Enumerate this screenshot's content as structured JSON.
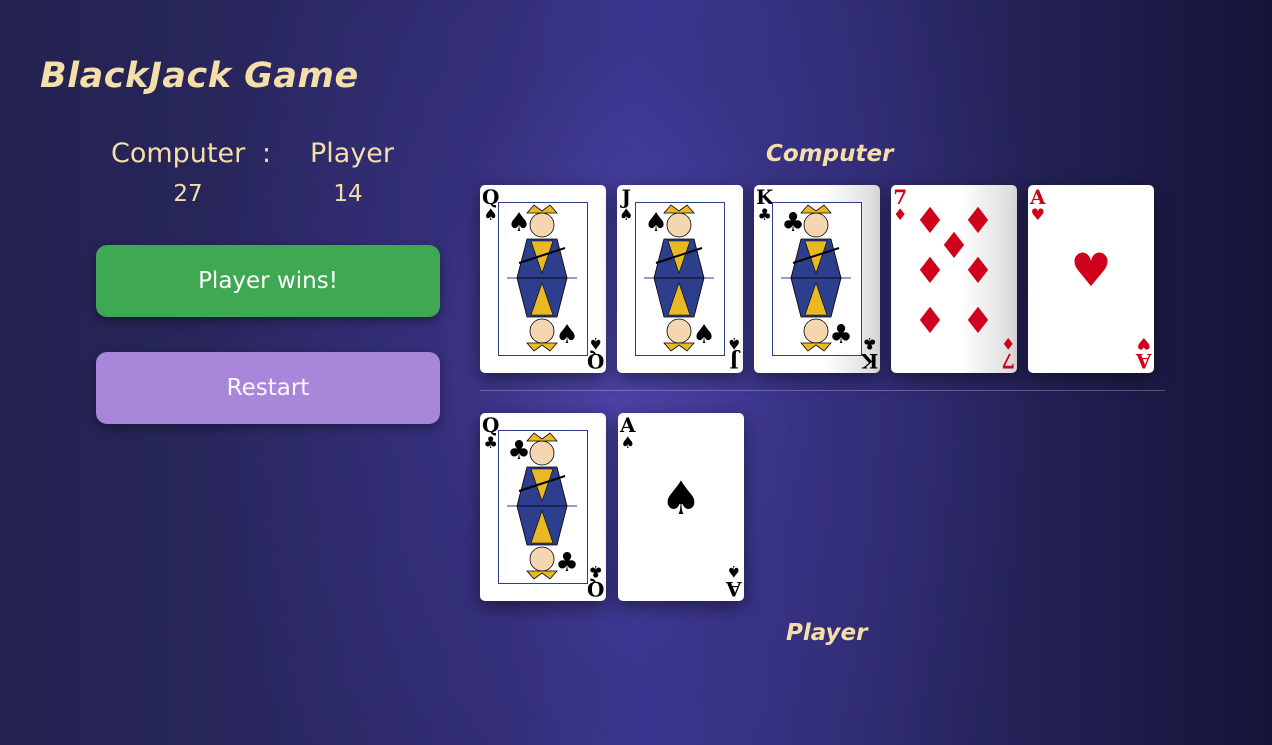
{
  "title": "BlackJack Game",
  "scoreboard": {
    "computer_label": "Computer",
    "separator": ":",
    "player_label": "Player",
    "computer_score": "27",
    "player_score": "14"
  },
  "status_button": "Player wins!",
  "restart_button": "Restart",
  "computer_hand": {
    "label": "Computer",
    "cards": [
      {
        "rank": "Q",
        "suit": "♠"
      },
      {
        "rank": "J",
        "suit": "♠"
      },
      {
        "rank": "K",
        "suit": "♣"
      },
      {
        "rank": "7",
        "suit": "♦"
      },
      {
        "rank": "A",
        "suit": "♥"
      }
    ]
  },
  "player_hand": {
    "label": "Player",
    "cards": [
      {
        "rank": "Q",
        "suit": "♣"
      },
      {
        "rank": "A",
        "suit": "♠"
      }
    ]
  },
  "colors": {
    "accent_text": "#f5dfa8",
    "status_green": "#3ea852",
    "restart_purple": "#a886da",
    "suit_red": "#d0021b"
  }
}
